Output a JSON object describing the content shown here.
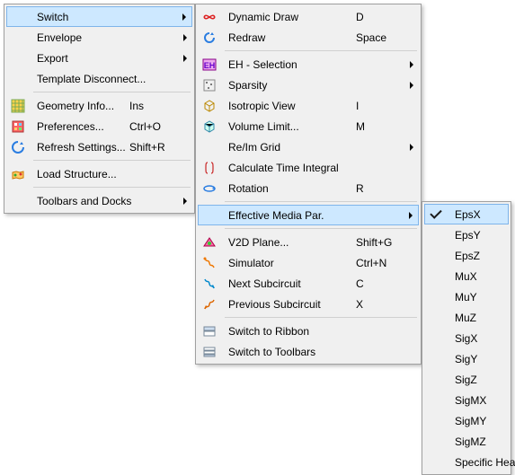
{
  "menu1": {
    "items": [
      {
        "label": "Switch",
        "shortcut": "",
        "arrow": true,
        "highlight": true,
        "icon": "",
        "sep": false
      },
      {
        "label": "Envelope",
        "shortcut": "",
        "arrow": true,
        "icon": "",
        "sep": false
      },
      {
        "label": "Export",
        "shortcut": "",
        "arrow": true,
        "icon": "",
        "sep": false
      },
      {
        "label": "Template Disconnect...",
        "shortcut": "",
        "arrow": false,
        "icon": "",
        "sep": false
      },
      {
        "sep": true
      },
      {
        "label": "Geometry Info...",
        "shortcut": "Ins",
        "arrow": false,
        "icon": "geometry-icon",
        "sep": false
      },
      {
        "label": "Preferences...",
        "shortcut": "Ctrl+O",
        "arrow": false,
        "icon": "preferences-icon",
        "sep": false
      },
      {
        "label": "Refresh Settings...",
        "shortcut": "Shift+R",
        "arrow": false,
        "icon": "refresh-icon",
        "sep": false
      },
      {
        "sep": true
      },
      {
        "label": "Load Structure...",
        "shortcut": "",
        "arrow": false,
        "icon": "load-icon",
        "sep": false
      },
      {
        "sep": true
      },
      {
        "label": "Toolbars and Docks",
        "shortcut": "",
        "arrow": true,
        "icon": "",
        "sep": false
      }
    ]
  },
  "menu2": {
    "items": [
      {
        "label": "Dynamic Draw",
        "shortcut": "D",
        "arrow": false,
        "icon": "dynamic-draw-icon",
        "sep": false
      },
      {
        "label": "Redraw",
        "shortcut": "Space",
        "arrow": false,
        "icon": "redraw-icon",
        "sep": false
      },
      {
        "sep": true
      },
      {
        "label": "EH - Selection",
        "shortcut": "",
        "arrow": true,
        "icon": "eh-icon",
        "sep": false
      },
      {
        "label": "Sparsity",
        "shortcut": "",
        "arrow": true,
        "icon": "sparsity-icon",
        "sep": false
      },
      {
        "label": "Isotropic View",
        "shortcut": "I",
        "arrow": false,
        "icon": "isotropic-icon",
        "sep": false
      },
      {
        "label": "Volume Limit...",
        "shortcut": "M",
        "arrow": false,
        "icon": "volume-icon",
        "sep": false
      },
      {
        "label": "Re/Im Grid",
        "shortcut": "",
        "arrow": true,
        "icon": "",
        "sep": false
      },
      {
        "label": "Calculate Time Integral",
        "shortcut": "",
        "arrow": false,
        "icon": "integral-icon",
        "sep": false
      },
      {
        "label": "Rotation",
        "shortcut": "R",
        "arrow": false,
        "icon": "rotation-icon",
        "sep": false
      },
      {
        "sep": true
      },
      {
        "label": "Effective Media Par.",
        "shortcut": "",
        "arrow": true,
        "icon": "",
        "highlight": true,
        "sep": false
      },
      {
        "sep": true
      },
      {
        "label": "V2D Plane...",
        "shortcut": "Shift+G",
        "arrow": false,
        "icon": "v2d-icon",
        "sep": false
      },
      {
        "label": "Simulator",
        "shortcut": "Ctrl+N",
        "arrow": false,
        "icon": "simulator-icon",
        "sep": false
      },
      {
        "label": "Next Subcircuit",
        "shortcut": "C",
        "arrow": false,
        "icon": "next-icon",
        "sep": false
      },
      {
        "label": "Previous Subcircuit",
        "shortcut": "X",
        "arrow": false,
        "icon": "prev-icon",
        "sep": false
      },
      {
        "sep": true
      },
      {
        "label": "Switch to Ribbon",
        "shortcut": "",
        "arrow": false,
        "icon": "ribbon-icon",
        "sep": false
      },
      {
        "label": "Switch to Toolbars",
        "shortcut": "",
        "arrow": false,
        "icon": "toolbars-icon",
        "sep": false
      }
    ]
  },
  "menu3": {
    "items": [
      {
        "label": "EpsX",
        "check": true
      },
      {
        "label": "EpsY"
      },
      {
        "label": "EpsZ"
      },
      {
        "label": "MuX"
      },
      {
        "label": "MuY"
      },
      {
        "label": "MuZ"
      },
      {
        "label": "SigX"
      },
      {
        "label": "SigY"
      },
      {
        "label": "SigZ"
      },
      {
        "label": "SigMX"
      },
      {
        "label": "SigMY"
      },
      {
        "label": "SigMZ"
      },
      {
        "label": "Specific Heat"
      }
    ]
  }
}
